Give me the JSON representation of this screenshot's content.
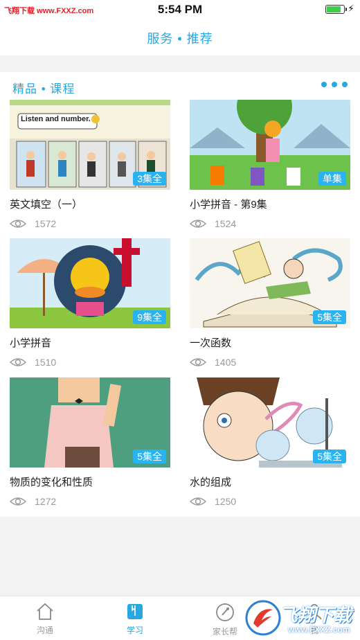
{
  "status_bar": {
    "watermark": "飞翔下载 www.FXXZ.com",
    "time": "5:54 PM",
    "battery_level": 0.85
  },
  "header": {
    "title": "服务 • 推荐"
  },
  "section": {
    "title": "精品 • 课程"
  },
  "courses": [
    {
      "title": "英文填空（一）",
      "views": "1572",
      "badge": "3集全",
      "thumb_text": "Listen and number."
    },
    {
      "title": "小学拼音 - 第9集",
      "views": "1524",
      "badge": "单集"
    },
    {
      "title": "小学拼音",
      "views": "1510",
      "badge": "9集全"
    },
    {
      "title": "一次函数",
      "views": "1405",
      "badge": "5集全"
    },
    {
      "title": "物质的变化和性质",
      "views": "1272",
      "badge": "5集全"
    },
    {
      "title": "水的组成",
      "views": "1250",
      "badge": "5集全"
    }
  ],
  "tabs": [
    {
      "label": "沟通",
      "icon": "home-icon"
    },
    {
      "label": "学习",
      "icon": "book-icon",
      "active": true
    },
    {
      "label": "家长帮",
      "icon": "compass-icon"
    },
    {
      "label": "我",
      "icon": "person-icon"
    }
  ],
  "watermark_logo": {
    "main": "飞翔下载",
    "sub": "www.FXXZ.com"
  },
  "colors": {
    "accent": "#27a8e0",
    "badge": "#29b3f0"
  }
}
